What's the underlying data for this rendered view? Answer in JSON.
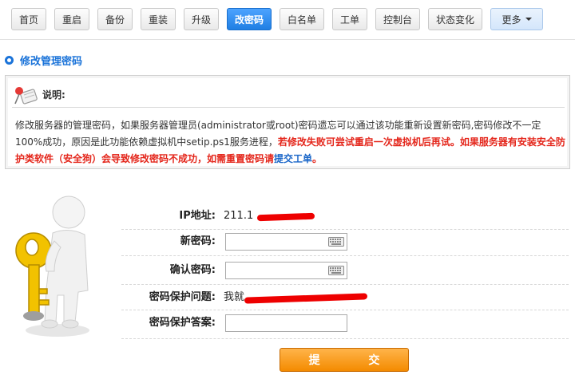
{
  "tabs": [
    {
      "label": "首页",
      "active": false
    },
    {
      "label": "重启",
      "active": false
    },
    {
      "label": "备份",
      "active": false
    },
    {
      "label": "重装",
      "active": false
    },
    {
      "label": "升级",
      "active": false
    },
    {
      "label": "改密码",
      "active": true
    },
    {
      "label": "白名单",
      "active": false
    },
    {
      "label": "工单",
      "active": false
    },
    {
      "label": "控制台",
      "active": false
    },
    {
      "label": "状态变化",
      "active": false
    },
    {
      "label": "更多",
      "active": false,
      "dropdown": true
    }
  ],
  "section": {
    "title": "修改管理密码"
  },
  "notice": {
    "heading": "说明:",
    "text_normal": "修改服务器的管理密码，如果服务器管理员(administrator或root)密码遗忘可以通过该功能重新设置新密码,密码修改不一定100%成功，原因是此功能依赖虚拟机中setip.ps1服务进程，",
    "text_warning": "若修改失败可尝试重启一次虚拟机后再试。如果服务器有安装安全防护类软件（安全狗）会导致修改密码不成功，如需重置密码请",
    "link_text": "提交工单",
    "text_end": "。"
  },
  "form": {
    "ip_label": "IP地址:",
    "ip_value": "211.1",
    "new_password_label": "新密码:",
    "new_password_value": "",
    "confirm_password_label": "确认密码:",
    "confirm_password_value": "",
    "question_label": "密码保护问题:",
    "question_value": "我就",
    "answer_label": "密码保护答案:",
    "answer_value": ""
  },
  "submit_label": "提 交",
  "colors": {
    "accent": "#1f7fe3",
    "warning": "#e4261b",
    "submit": "#f48b00"
  }
}
